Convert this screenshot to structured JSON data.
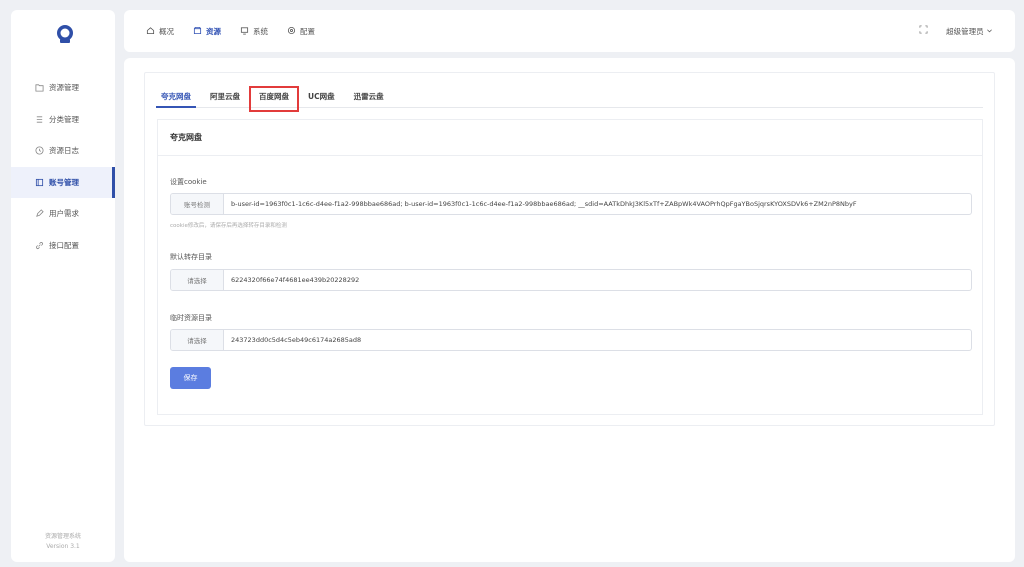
{
  "sidebar": {
    "items": [
      {
        "label": "资源管理",
        "icon": "folder-icon"
      },
      {
        "label": "分类管理",
        "icon": "list-icon"
      },
      {
        "label": "资源日志",
        "icon": "clock-icon"
      },
      {
        "label": "账号管理",
        "icon": "account-icon",
        "active": true
      },
      {
        "label": "用户需求",
        "icon": "edit-icon"
      },
      {
        "label": "接口配置",
        "icon": "link-icon"
      }
    ],
    "footer_name": "资源管理系统",
    "footer_version": "Version 3.1"
  },
  "topbar": {
    "menu": [
      {
        "label": "概况",
        "icon": "home-icon"
      },
      {
        "label": "资源",
        "icon": "box-icon",
        "active": true
      },
      {
        "label": "系统",
        "icon": "monitor-icon"
      },
      {
        "label": "配置",
        "icon": "settings-icon"
      }
    ],
    "user": "超级管理员"
  },
  "tabs": [
    {
      "label": "夸克网盘",
      "active": true
    },
    {
      "label": "阿里云盘"
    },
    {
      "label": "百度网盘",
      "highlighted": true
    },
    {
      "label": "UC网盘"
    },
    {
      "label": "迅雷云盘"
    }
  ],
  "panel": {
    "title": "夸克网盘",
    "cookie_label": "设置cookie",
    "cookie_addon": "账号检测",
    "cookie_value": "b-user-id=1963f0c1-1c6c-d4ee-f1a2-998bbae686ad; b-user-id=1963f0c1-1c6c-d4ee-f1a2-998bbae686ad; __sdid=AATkDhkJ3Kl5xTf+ZABpWk4VAOPrhQpFgaYBoSjqrsKYOXSDVk6+ZM2nP8NbyF",
    "cookie_hint": "cookie修改后，请保存后再选择转存目录和检测",
    "dir_label": "默认转存目录",
    "dir_addon": "请选择",
    "dir_value": "6224320f66e74f4681ee439b20228292",
    "temp_label": "临时资源目录",
    "temp_addon": "请选择",
    "temp_value": "243723dd0c5d4c5eb49c6174a2685ad8",
    "save_label": "保存"
  },
  "colors": {
    "accent": "#3555b5",
    "button": "#5b7de0",
    "highlight": "#e23b3b"
  }
}
